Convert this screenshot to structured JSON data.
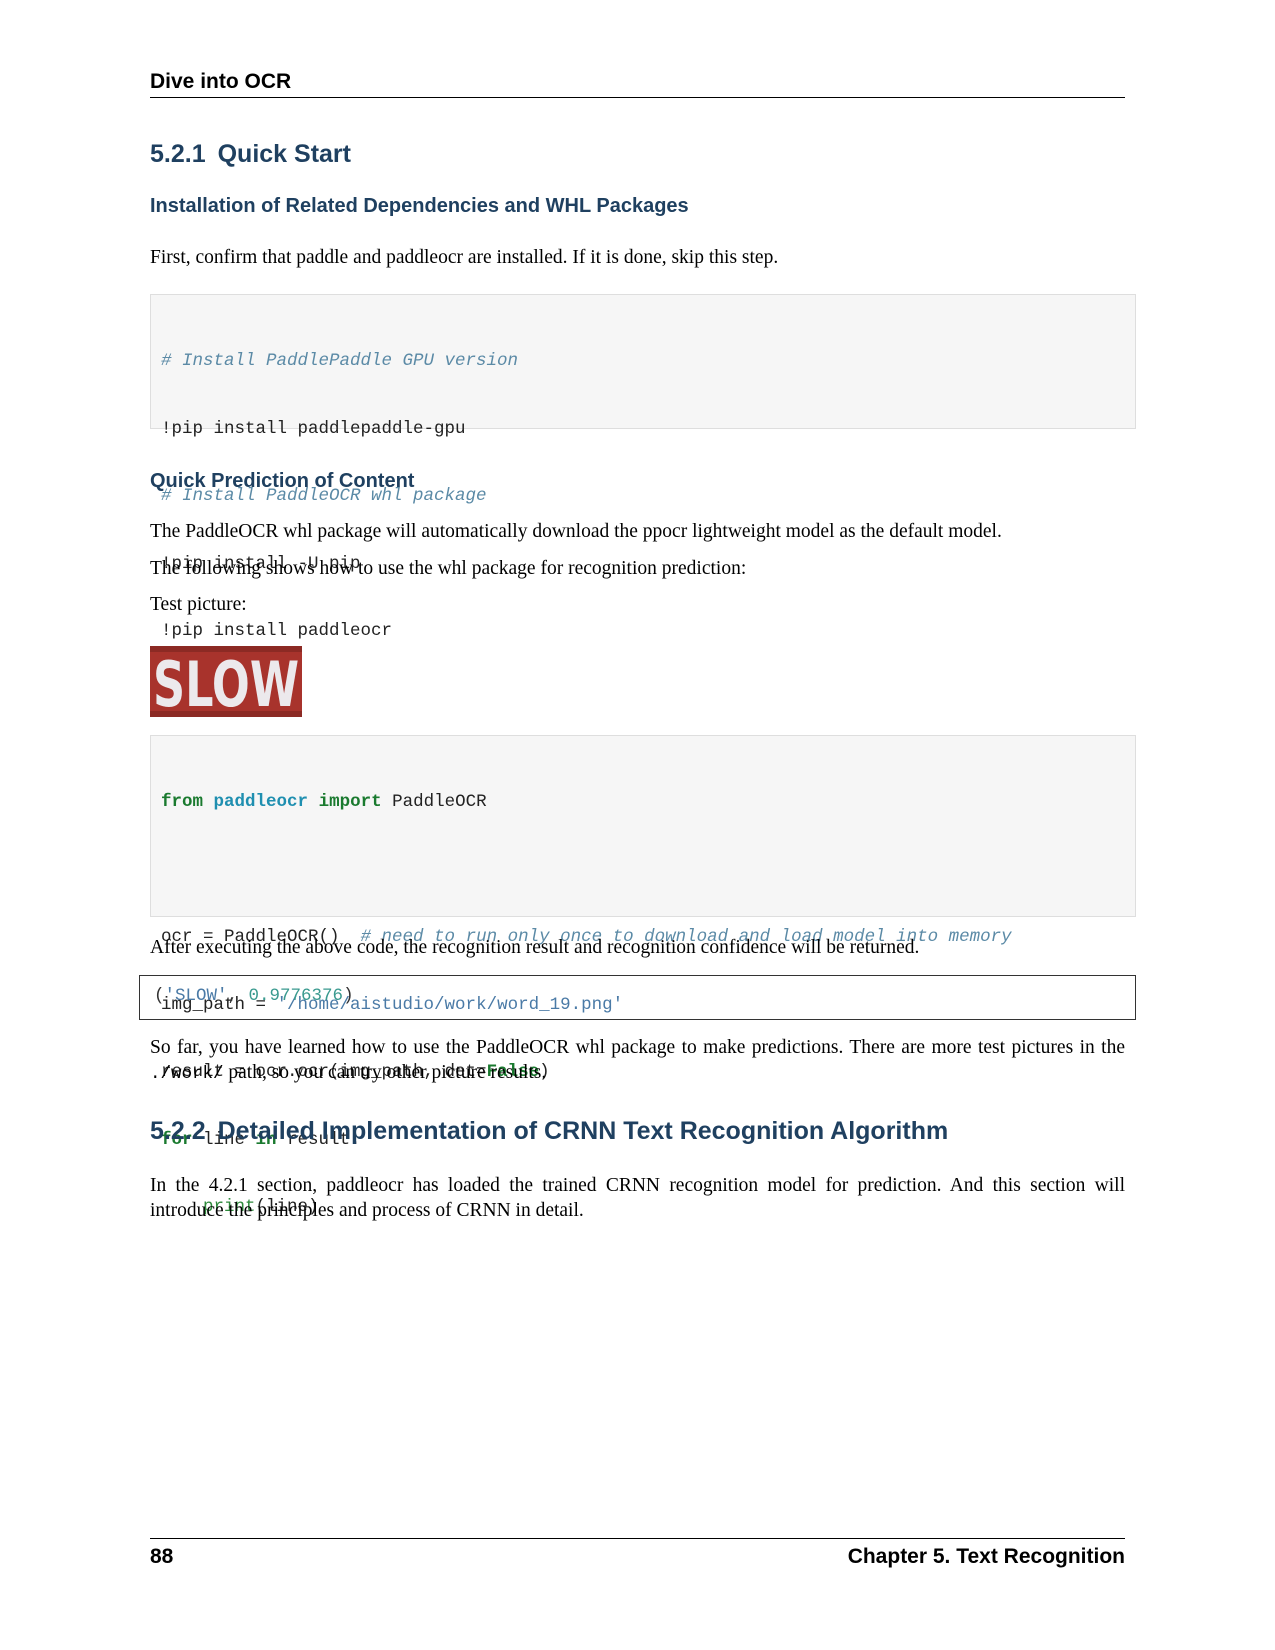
{
  "header": {
    "running_title": "Dive into OCR"
  },
  "section_521": {
    "number": "5.2.1",
    "title": "Quick Start"
  },
  "install": {
    "heading": "Installation of Related Dependencies and WHL Packages",
    "intro": "First, confirm that paddle and paddleocr are installed. If it is done, skip this step.",
    "code_lines": [
      "# Install PaddlePaddle GPU version",
      "!pip install paddlepaddle-gpu",
      "# Install PaddleOCR whl package",
      "!pip install -U pip",
      "!pip install paddleocr"
    ]
  },
  "predict": {
    "heading": "Quick Prediction of Content",
    "p1": "The PaddleOCR whl package will automatically download the ppocr lightweight model as the default model.",
    "p2": "The following shows how to use the whl package for recognition prediction:",
    "p3": "Test picture:",
    "image_text": "SLOW",
    "code": {
      "l1_from": "from",
      "l1_module": "paddleocr",
      "l1_import": "import",
      "l1_name": "PaddleOCR",
      "l3_code": "ocr = PaddleOCR()",
      "l3_comment": "# need to run only once to download and load model into memory",
      "l4_lhs": "img_path = ",
      "l4_str": "'/home/aistudio/work/word_19.png'",
      "l5_code": "result = ocr.ocr(img_path, det=",
      "l5_false": "False",
      "l5_close": ")",
      "l6_for": "for",
      "l6_mid": " line ",
      "l6_in": "in",
      "l6_end": " result:",
      "l7_indent": "    ",
      "l7_print": "print",
      "l7_rest": "(line)"
    },
    "after": "After executing the above code, the recognition result and recognition confidence will be returned.",
    "output": {
      "open": "(",
      "str": "'SLOW'",
      "sep": ", ",
      "num": "0.9776376",
      "close": ")"
    },
    "sofar_a": "So far, you have learned how to use the PaddleOCR whl package to make predictions. There are more test pictures in the",
    "sofar_code": "./work/",
    "sofar_b": " path, so you can try other picture results."
  },
  "section_522": {
    "number": "5.2.2",
    "title": "Detailed Implementation of CRNN Text Recognition Algorithm",
    "body": "In the 4.2.1 section, paddleocr has loaded the trained CRNN recognition model for prediction. And this section will introduce the principles and process of CRNN in detail."
  },
  "footer": {
    "page_number": "88",
    "chapter": "Chapter 5.  Text Recognition"
  }
}
